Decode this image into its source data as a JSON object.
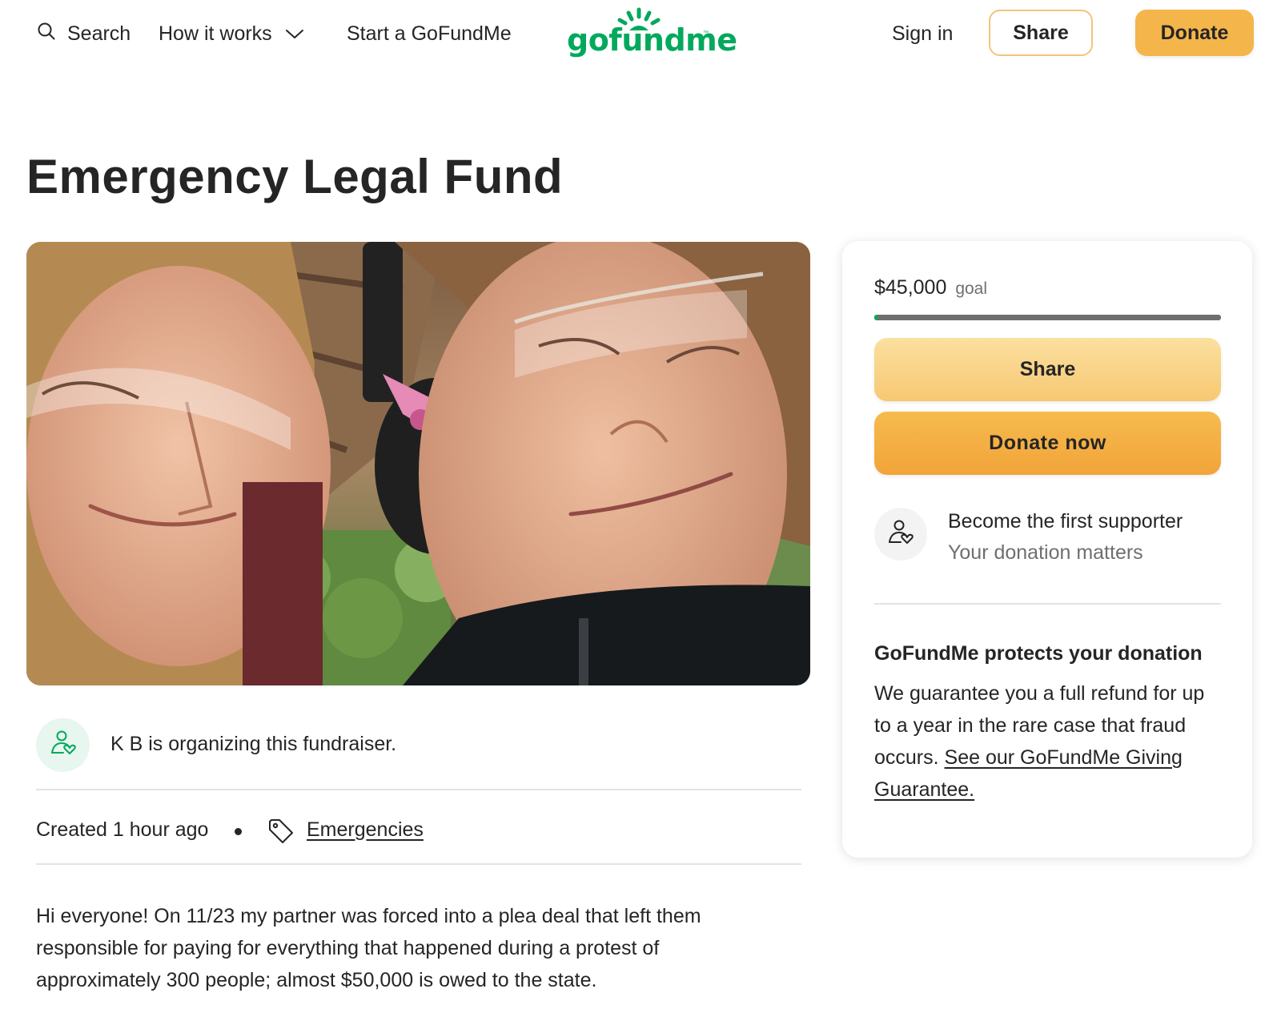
{
  "header": {
    "search_label": "Search",
    "how_it_works_label": "How it works",
    "start_label": "Start a GoFundMe",
    "logo_text": "gofundme",
    "logo_tm": "™",
    "signin_label": "Sign in",
    "share_label": "Share",
    "donate_label": "Donate"
  },
  "campaign": {
    "title": "Emergency Legal Fund",
    "organizer_text": "K B is organizing this fundraiser.",
    "created": "Created 1 hour ago",
    "category": "Emergencies",
    "story": "Hi everyone! On 11/23 my partner was forced into a plea deal that left them responsible for paying for everything that happened during a protest of approximately 300 people; almost $50,000 is owed to the state."
  },
  "donation_card": {
    "goal_amount": "$45,000",
    "goal_label": "goal",
    "progress_fraction": 0.01,
    "share_label": "Share",
    "donate_now_label": "Donate now",
    "supporter_title": "Become the first supporter",
    "supporter_subtitle": "Your donation matters",
    "protect_title": "GoFundMe protects your donation",
    "protect_body": "We guarantee you a full refund for up to a year in the rare case that fraud occurs.",
    "protect_link": "See our GoFundMe Giving Guarantee."
  },
  "colors": {
    "brand_green": "#02a95c",
    "donate_orange": "#f4b54a",
    "share_light": "#fbe0a0"
  },
  "icons": {
    "search": "search-icon",
    "chevron": "chevron-down-icon",
    "organizer": "person-heart-icon",
    "tag": "tag-icon",
    "supporter": "person-heart-icon",
    "logo_sun": "sun-rays-icon"
  }
}
